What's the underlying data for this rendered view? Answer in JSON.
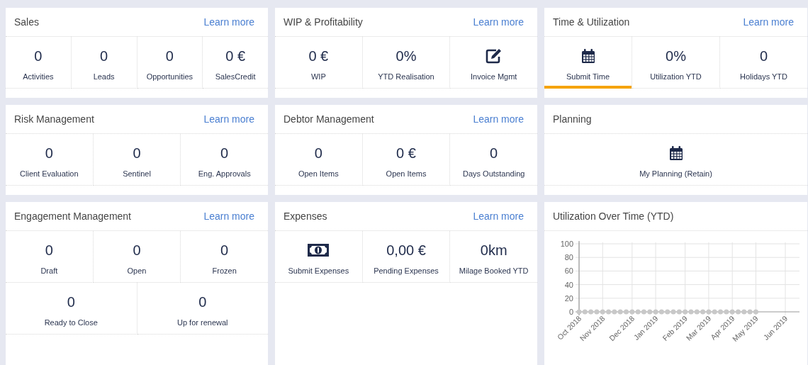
{
  "cards": [
    {
      "title": "Sales",
      "link": "Learn more",
      "tile_rows": [
        [
          {
            "kind": "value",
            "value": "0",
            "label": "Activities",
            "selected": false
          },
          {
            "kind": "value",
            "value": "0",
            "label": "Leads",
            "selected": false
          },
          {
            "kind": "value",
            "value": "0",
            "label": "Opportunities",
            "selected": false
          },
          {
            "kind": "value",
            "value": "0 €",
            "label": "SalesCredit",
            "selected": false
          }
        ]
      ]
    },
    {
      "title": "WIP & Profitability",
      "link": "Learn more",
      "tile_rows": [
        [
          {
            "kind": "value",
            "value": "0 €",
            "label": "WIP",
            "selected": false
          },
          {
            "kind": "value",
            "value": "0%",
            "label": "YTD Realisation",
            "selected": false
          },
          {
            "kind": "edit",
            "label": "Invoice Mgmt",
            "selected": false
          }
        ]
      ]
    },
    {
      "title": "Time & Utilization",
      "link": "Learn more",
      "tile_rows": [
        [
          {
            "kind": "calendar",
            "label": "Submit Time",
            "selected": true
          },
          {
            "kind": "value",
            "value": "0%",
            "label": "Utilization YTD",
            "selected": false
          },
          {
            "kind": "value",
            "value": "0",
            "label": "Holidays YTD",
            "selected": false
          }
        ]
      ]
    },
    {
      "title": "Risk Management",
      "link": "Learn more",
      "tile_rows": [
        [
          {
            "kind": "value",
            "value": "0",
            "label": "Client Evaluation",
            "selected": false
          },
          {
            "kind": "value",
            "value": "0",
            "label": "Sentinel",
            "selected": false
          },
          {
            "kind": "value",
            "value": "0",
            "label": "Eng. Approvals",
            "selected": false
          }
        ]
      ]
    },
    {
      "title": "Debtor Management",
      "link": "Learn more",
      "tile_rows": [
        [
          {
            "kind": "value",
            "value": "0",
            "label": "Open Items",
            "selected": false
          },
          {
            "kind": "value",
            "value": "0 €",
            "label": "Open Items",
            "selected": false
          },
          {
            "kind": "value",
            "value": "0",
            "label": "Days Outstanding",
            "selected": false
          }
        ]
      ]
    },
    {
      "title": "Planning",
      "tile_rows": [
        [
          {
            "kind": "calendar",
            "label": "My Planning (Retain)",
            "selected": false
          }
        ]
      ]
    },
    {
      "title": "Engagement Management",
      "link": "Learn more",
      "tile_rows": [
        [
          {
            "kind": "value",
            "value": "0",
            "label": "Draft",
            "selected": false
          },
          {
            "kind": "value",
            "value": "0",
            "label": "Open",
            "selected": false
          },
          {
            "kind": "value",
            "value": "0",
            "label": "Frozen",
            "selected": false
          }
        ],
        [
          {
            "kind": "value",
            "value": "0",
            "label": "Ready to Close",
            "selected": false
          },
          {
            "kind": "value",
            "value": "0",
            "label": "Up for renewal",
            "selected": false
          }
        ]
      ]
    },
    {
      "title": "Expenses",
      "link": "Learn more",
      "tile_rows": [
        [
          {
            "kind": "bill",
            "label": "Submit Expenses",
            "selected": false
          },
          {
            "kind": "value",
            "value": "0,00 €",
            "label": "Pending Expenses",
            "selected": false
          },
          {
            "kind": "value",
            "value": "0km",
            "label": "Milage Booked YTD",
            "selected": false
          }
        ]
      ]
    },
    {
      "title": "Utilization Over Time (YTD)",
      "chart_data": {
        "type": "line",
        "categories": [
          "Oct 2018",
          null,
          null,
          null,
          "Nov 2018",
          null,
          null,
          null,
          null,
          "Dec 2018",
          null,
          null,
          null,
          "Jan 2019",
          null,
          null,
          null,
          null,
          "Feb 2019",
          null,
          null,
          null,
          "Mar 2019",
          null,
          null,
          null,
          "Apr 2019",
          null,
          null,
          null,
          "May 2019",
          null,
          null,
          null,
          null,
          "Jun 2019"
        ],
        "grid": true,
        "series": [
          {
            "marker": true,
            "color": "#c8c8c8",
            "values": [
              0,
              0,
              0,
              0,
              0,
              0,
              0,
              0,
              0,
              0,
              0,
              0,
              0,
              0,
              0,
              0,
              0,
              0,
              0,
              0,
              0,
              0,
              0,
              0,
              0,
              0,
              0,
              0,
              0,
              0,
              0,
              null,
              null,
              null,
              null,
              null
            ]
          }
        ],
        "ylim": [
          0,
          100
        ],
        "yticks": [
          0,
          20,
          40,
          60,
          80,
          100
        ]
      }
    }
  ]
}
